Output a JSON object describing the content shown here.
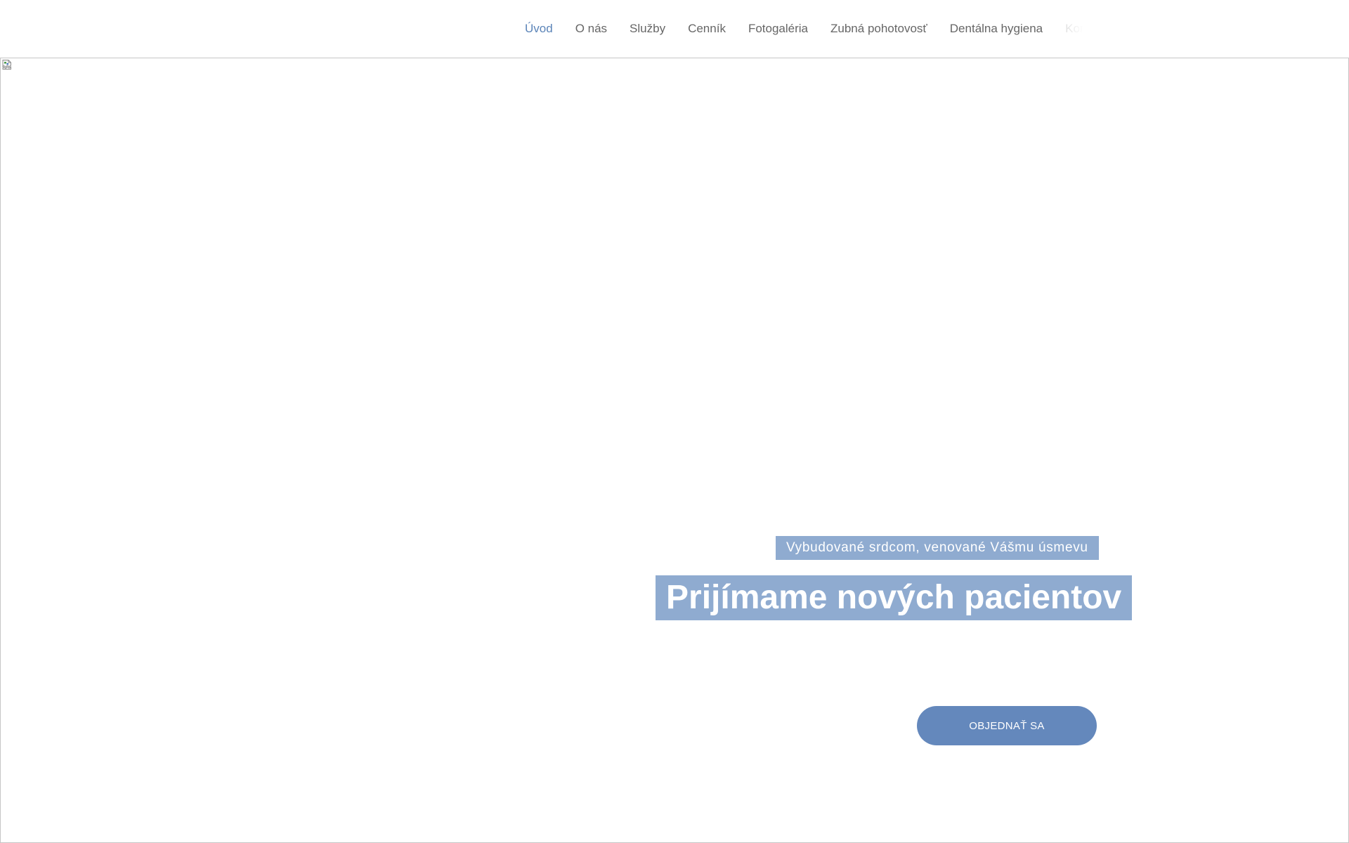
{
  "colors": {
    "accent": "#5b84b8",
    "nav_text": "#666666",
    "nav_faded": "#bdbdbd",
    "label_background": "#8fabd0",
    "cta_background": "#6488bc",
    "text_on_accent": "#ffffff"
  },
  "nav": {
    "items": [
      {
        "label": "Úvod",
        "active": true
      },
      {
        "label": "O nás"
      },
      {
        "label": "Služby"
      },
      {
        "label": "Cenník"
      },
      {
        "label": "Fotogaléria"
      },
      {
        "label": "Zubná pohotovosť"
      },
      {
        "label": "Dentálna hygiena"
      },
      {
        "label": "Kontakt"
      }
    ]
  },
  "hero": {
    "image_icon": "broken-image-icon",
    "tagline": "Vybudované srdcom, venované Vášmu úsmevu",
    "headline": "Prijímame nových pacientov",
    "cta_label": "OBJEDNAŤ SA"
  }
}
